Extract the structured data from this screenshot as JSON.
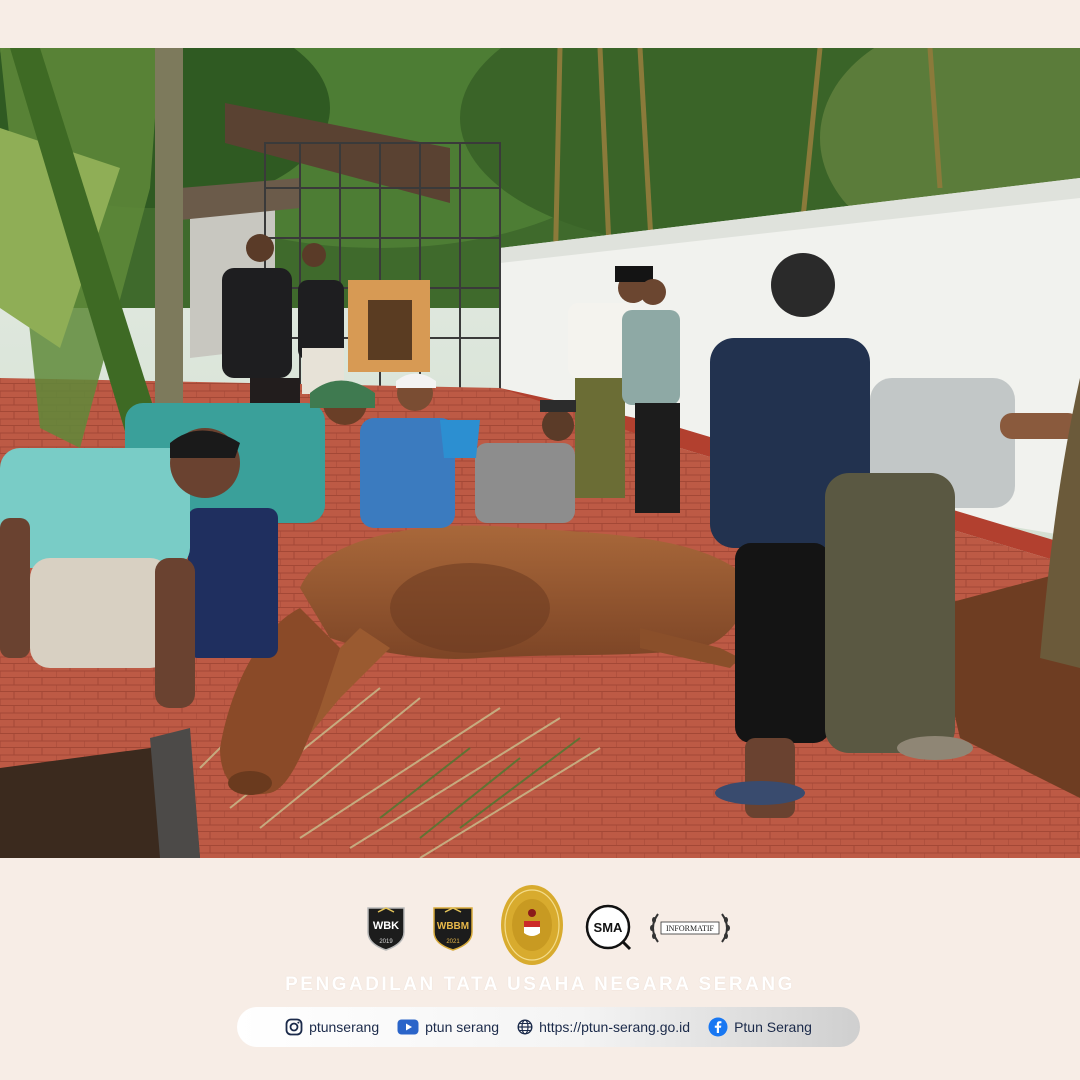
{
  "photo": {
    "subject": "qurban-cattle-slaughter-scene"
  },
  "logos": [
    {
      "name": "wbk-badge",
      "text": "WBK",
      "year": "2019"
    },
    {
      "name": "wbbm-badge",
      "text": "WBBM",
      "year": "2021"
    },
    {
      "name": "ptun-seal",
      "text": ""
    },
    {
      "name": "sma-logo",
      "text": "SMA"
    },
    {
      "name": "informatif-award",
      "text": "INFORMATIF"
    }
  ],
  "org_title": "PENGADILAN TATA USAHA NEGARA SERANG",
  "social": {
    "instagram": "ptunserang",
    "youtube": "ptun serang",
    "website": "https://ptun-serang.go.id",
    "facebook": "Ptun Serang"
  },
  "colors": {
    "background": "#f7ede6",
    "badge_dark": "#1c1c1c",
    "gold": "#d8ab2e",
    "instagram": "#1b2a4a",
    "youtube": "#2a64c9",
    "facebook": "#1877f2"
  }
}
